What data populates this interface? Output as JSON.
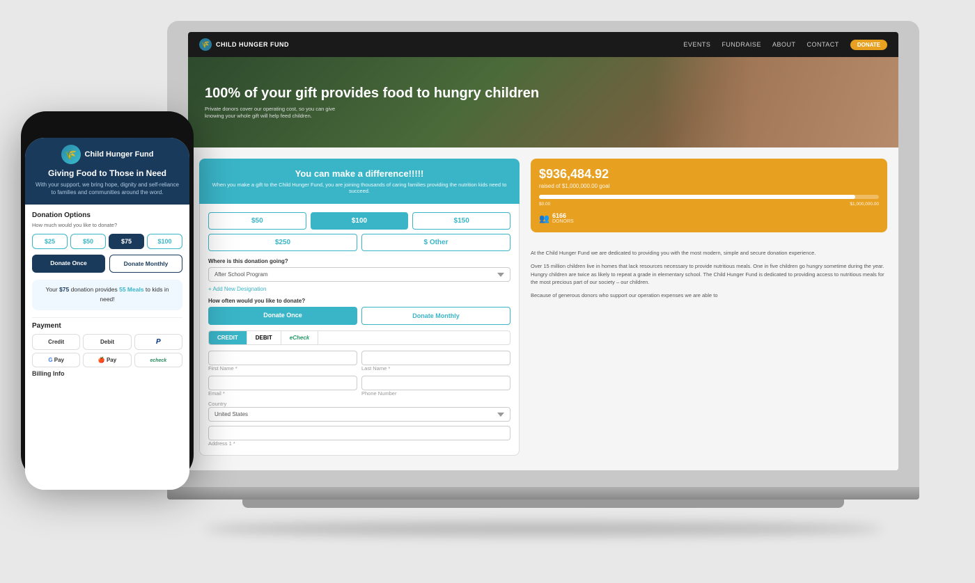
{
  "scene": {
    "bg_color": "#e8e8e8"
  },
  "laptop": {
    "nav": {
      "logo": "CHILD HUNGER FUND",
      "items": [
        "EVENTS",
        "FUNDRAISE",
        "ABOUT",
        "CONTACT"
      ],
      "donate_btn": "DONATE"
    },
    "hero": {
      "title": "100% of your gift provides food to hungry children",
      "subtitle": "Private donors cover our operating cost, so you can give knowing your whole gift will help feed children."
    },
    "donation": {
      "header_title": "You can make a difference!!!!!",
      "header_sub": "When you make a gift to the Child Hunger Fund, you are joining thousands of caring families providing the nutrition kids need to succeed.",
      "amounts": [
        "$50",
        "$100",
        "$150",
        "$250",
        "$ Other"
      ],
      "selected_amount": "$100",
      "designation_label": "Where is this donation going?",
      "designation_value": "After School Program",
      "add_designation": "+ Add New Designation",
      "frequency_label": "How often would you like to donate?",
      "donate_once": "Donate Once",
      "donate_monthly": "Donate Monthly",
      "payment_tabs": [
        "CREDIT",
        "DEBIT",
        "eCheck"
      ],
      "active_payment": "CREDIT",
      "first_name_label": "First Name *",
      "last_name_label": "Last Name *",
      "email_label": "Email *",
      "phone_label": "Phone Number",
      "country_label": "Country",
      "country_value": "United States",
      "address_label": "Address 1 *"
    },
    "progress": {
      "amount": "$936,484.92",
      "goal_label": "raised of $1,000,000.00 goal",
      "bar_percent": 93,
      "left_label": "$0.00",
      "right_label": "$1,000,000.00",
      "donors_count": "6166",
      "donors_label": "DONORS"
    },
    "info": {
      "paragraph1": "At the Child Hunger Fund we are dedicated to providing you with the most modern, simple and secure donation experience.",
      "paragraph2": "Over 15 million children live in homes that lack resources necessary to provide nutritious meals. One in five children go hungry sometime during the year. Hungry children are twice as likely to repeat a grade in elementary school. The Child Hunger Fund is dedicated to providing access to nutritious meals for the most precious part of our society – our children.",
      "paragraph3": "Because of generous donors who support our operation expenses we are able to"
    }
  },
  "phone": {
    "org_name": "Child Hunger Fund",
    "tagline": "Giving Food to Those in Need",
    "sub": "With your support, we bring hope, dignity and self-reliance to families and communities around the word.",
    "donation_options_title": "Donation Options",
    "how_much": "How much would you like to donate?",
    "amounts": [
      "$25",
      "$50",
      "$75",
      "$100"
    ],
    "selected_amount": "$75",
    "donate_once": "Donate Once",
    "donate_monthly": "Donate Monthly",
    "impact_text": "Your $75 donation provides 55 Meals to kids in need!",
    "impact_amount": "$75",
    "impact_meals": "55 Meals",
    "payment_title": "Payment",
    "payment_options": [
      {
        "label": "Credit",
        "type": "credit"
      },
      {
        "label": "Debit",
        "type": "debit"
      },
      {
        "label": "P",
        "type": "paypal"
      },
      {
        "label": "G Pay",
        "type": "gpay"
      },
      {
        "label": "Apple Pay",
        "type": "applepay"
      },
      {
        "label": "echeck",
        "type": "echeck"
      }
    ],
    "billing_title": "Billing Info"
  }
}
